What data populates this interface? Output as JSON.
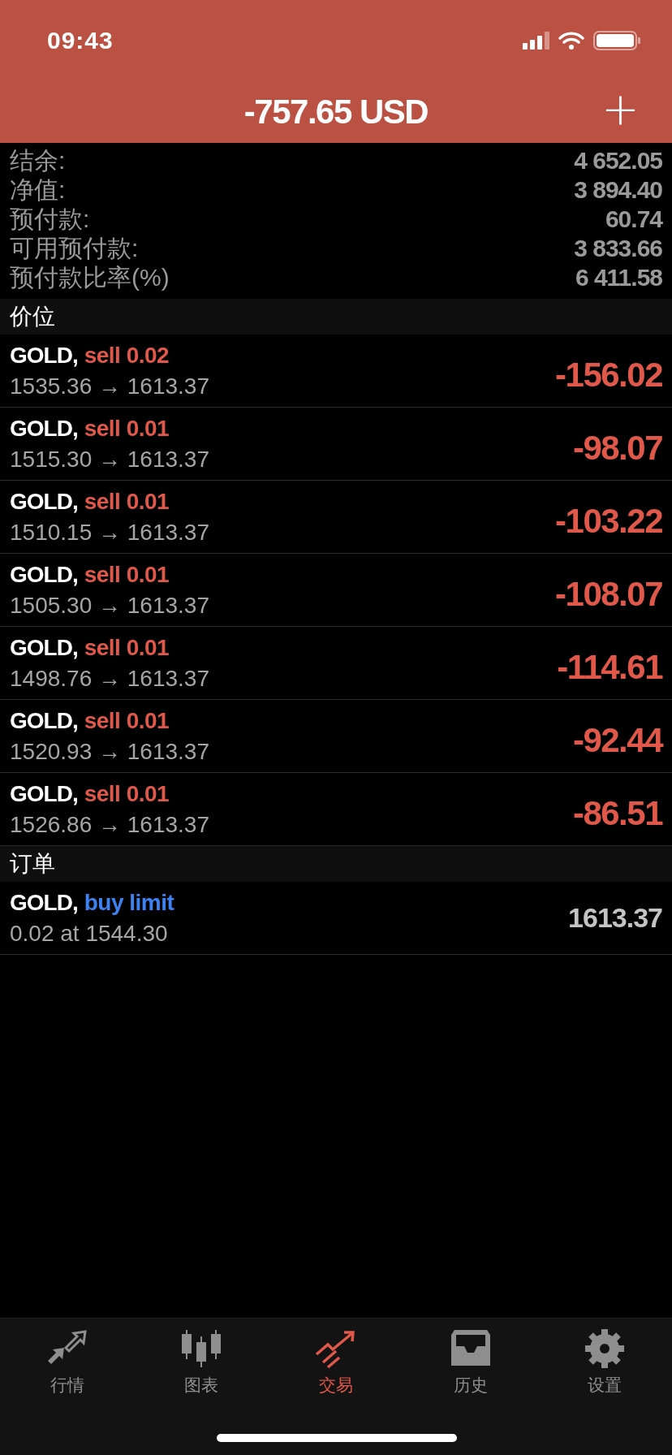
{
  "status_bar": {
    "time": "09:43"
  },
  "header": {
    "title": "-757.65 USD",
    "add_button": "+"
  },
  "summary": [
    {
      "label": "结余:",
      "value": "4 652.05"
    },
    {
      "label": "净值:",
      "value": "3 894.40"
    },
    {
      "label": "预付款:",
      "value": "60.74"
    },
    {
      "label": "可用预付款:",
      "value": "3 833.66"
    },
    {
      "label": "预付款比率(%)",
      "value": "6 411.58"
    }
  ],
  "positions": {
    "title": "价位",
    "rows": [
      {
        "symbol": "GOLD,",
        "kind": "sell",
        "action": "sell 0.02",
        "prices": "1535.36 → 1613.37",
        "profit": "-156.02"
      },
      {
        "symbol": "GOLD,",
        "kind": "sell",
        "action": "sell 0.01",
        "prices": "1515.30 → 1613.37",
        "profit": "-98.07"
      },
      {
        "symbol": "GOLD,",
        "kind": "sell",
        "action": "sell 0.01",
        "prices": "1510.15 → 1613.37",
        "profit": "-103.22"
      },
      {
        "symbol": "GOLD,",
        "kind": "sell",
        "action": "sell 0.01",
        "prices": "1505.30 → 1613.37",
        "profit": "-108.07"
      },
      {
        "symbol": "GOLD,",
        "kind": "sell",
        "action": "sell 0.01",
        "prices": "1498.76 → 1613.37",
        "profit": "-114.61"
      },
      {
        "symbol": "GOLD,",
        "kind": "sell",
        "action": "sell 0.01",
        "prices": "1520.93 → 1613.37",
        "profit": "-92.44"
      },
      {
        "symbol": "GOLD,",
        "kind": "sell",
        "action": "sell 0.01",
        "prices": "1526.86 → 1613.37",
        "profit": "-86.51"
      }
    ]
  },
  "orders": {
    "title": "订单",
    "rows": [
      {
        "symbol": "GOLD,",
        "kind": "buy",
        "action": "buy limit",
        "prices": "0.02 at 1544.30",
        "price": "1613.37"
      }
    ]
  },
  "tab_bar": [
    {
      "label": "行情",
      "kind": "quotes",
      "selected": false
    },
    {
      "label": "图表",
      "kind": "chart",
      "selected": false
    },
    {
      "label": "交易",
      "kind": "trade",
      "selected": true
    },
    {
      "label": "历史",
      "kind": "history",
      "selected": false
    },
    {
      "label": "设置",
      "kind": "settings",
      "selected": false
    }
  ]
}
